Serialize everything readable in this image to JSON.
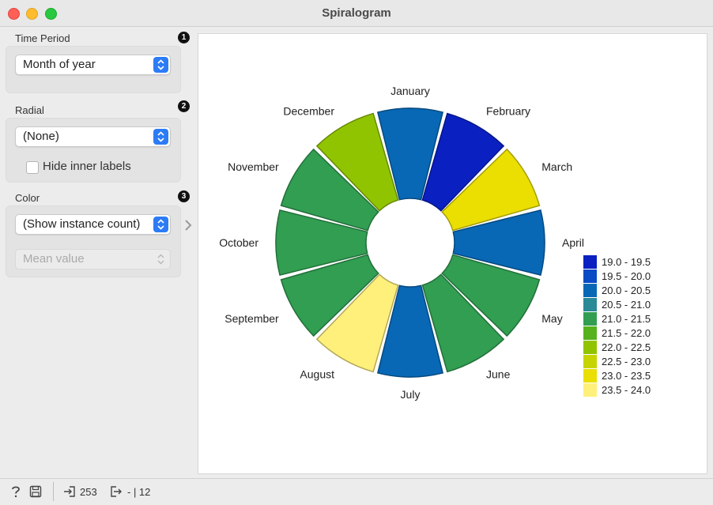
{
  "window": {
    "title": "Spiralogram"
  },
  "sidebar": {
    "time_period": {
      "label": "Time Period",
      "badge": "1",
      "value": "Month of year"
    },
    "radial": {
      "label": "Radial",
      "badge": "2",
      "value": "(None)",
      "hide_inner_labels": {
        "label": "Hide inner labels",
        "checked": false
      }
    },
    "color": {
      "label": "Color",
      "badge": "3",
      "value": "(Show instance count)",
      "aggregation": "Mean value",
      "aggregation_enabled": false
    }
  },
  "chart_data": {
    "type": "polar-bar",
    "title": "",
    "categories": [
      "January",
      "February",
      "March",
      "April",
      "May",
      "June",
      "July",
      "August",
      "September",
      "October",
      "November",
      "December"
    ],
    "colors": [
      "#0868b6",
      "#0a20c0",
      "#eadf00",
      "#0868b6",
      "#319e52",
      "#319e52",
      "#0868b6",
      "#fff07c",
      "#319e52",
      "#319e52",
      "#319e52",
      "#90c400"
    ],
    "legend": {
      "position": "right",
      "items": [
        {
          "label": "19.0 - 19.5",
          "color": "#0a20c0"
        },
        {
          "label": "19.5 - 20.0",
          "color": "#0a4cc6"
        },
        {
          "label": "20.0 - 20.5",
          "color": "#0868b6"
        },
        {
          "label": "20.5 - 21.0",
          "color": "#2a8a96"
        },
        {
          "label": "21.0 - 21.5",
          "color": "#319e52"
        },
        {
          "label": "21.5 - 22.0",
          "color": "#56b21c"
        },
        {
          "label": "22.0 - 22.5",
          "color": "#90c400"
        },
        {
          "label": "22.5 - 23.0",
          "color": "#c6d400"
        },
        {
          "label": "23.0 - 23.5",
          "color": "#eadf00"
        },
        {
          "label": "23.5 - 24.0",
          "color": "#fff07c"
        }
      ]
    }
  },
  "statusbar": {
    "input_count": "253",
    "output_count": "- | 12"
  }
}
